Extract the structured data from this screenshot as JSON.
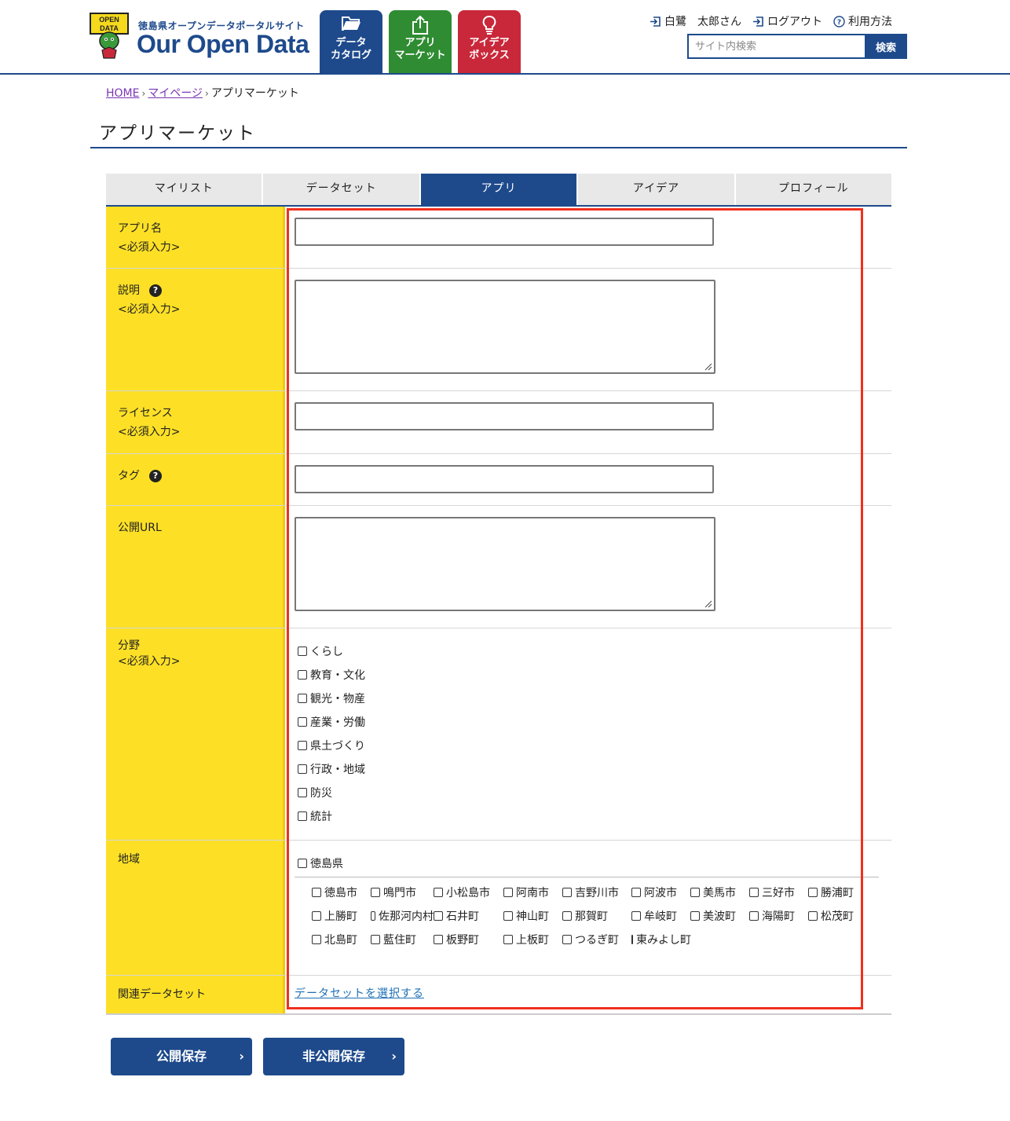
{
  "header": {
    "logo_badge": "OPEN\nDATA",
    "logo_sub": "徳島県オープンデータポータルサイト",
    "logo_main": "Our Open Data",
    "nav": [
      {
        "line1": "データ",
        "line2": "カタログ",
        "icon": "folder-open-icon",
        "color": "#1e4a8c"
      },
      {
        "line1": "アプリ",
        "line2": "マーケット",
        "icon": "share-upload-icon",
        "color": "#2f8c32"
      },
      {
        "line1": "アイデア",
        "line2": "ボックス",
        "icon": "lightbulb-icon",
        "color": "#c9283a"
      }
    ],
    "user_name": "白鷺　太郎さん",
    "logout": "ログアウト",
    "help": "利用方法",
    "search_placeholder": "サイト内検索",
    "search_button": "検索"
  },
  "breadcrumb": {
    "home": "HOME",
    "mypage": "マイページ",
    "current": "アプリマーケット"
  },
  "page_title": "アプリマーケット",
  "tabs": [
    "マイリスト",
    "データセット",
    "アプリ",
    "アイデア",
    "プロフィール"
  ],
  "active_tab": "アプリ",
  "form": {
    "required": "<必須入力>",
    "app_name": "アプリ名",
    "description": "説明",
    "license": "ライセンス",
    "tags": "タグ",
    "public_url": "公開URL",
    "category": "分野",
    "categories": [
      "くらし",
      "教育・文化",
      "観光・物産",
      "産業・労働",
      "県土づくり",
      "行政・地域",
      "防災",
      "統計"
    ],
    "region": "地域",
    "prefecture": "徳島県",
    "cities": [
      "徳島市",
      "鳴門市",
      "小松島市",
      "阿南市",
      "吉野川市",
      "阿波市",
      "美馬市",
      "三好市",
      "勝浦町",
      "上勝町",
      "佐那河内村",
      "石井町",
      "神山町",
      "那賀町",
      "牟岐町",
      "美波町",
      "海陽町",
      "松茂町",
      "北島町",
      "藍住町",
      "板野町",
      "上板町",
      "つるぎ町",
      "東みよし町"
    ],
    "related_dataset": "関連データセット",
    "select_dataset": "データセットを選択する"
  },
  "buttons": {
    "public_save": "公開保存",
    "private_save": "非公開保存"
  },
  "colors": {
    "brand": "#1e4a8c",
    "label_bg": "#fde026",
    "highlight": "#f0301e"
  }
}
